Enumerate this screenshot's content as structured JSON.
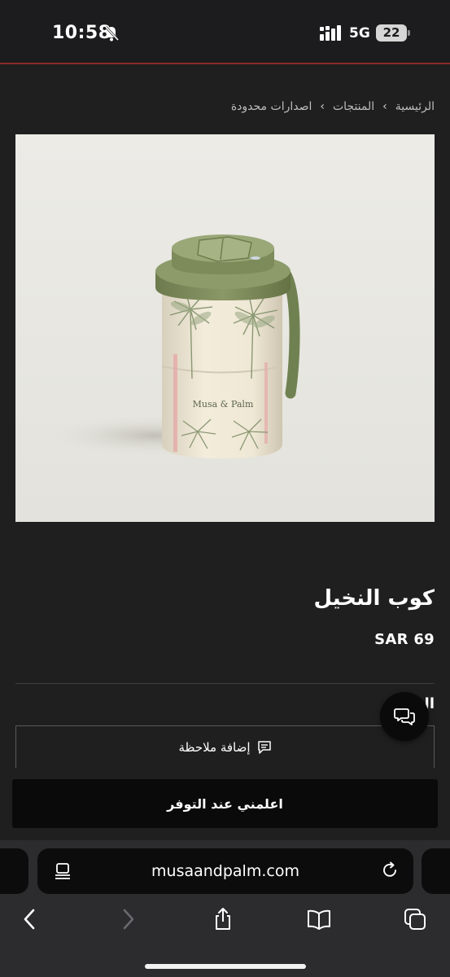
{
  "status_bar": {
    "time": "10:58",
    "network": "5G",
    "battery": "22"
  },
  "breadcrumb": {
    "home": "الرئيسية",
    "products": "المنتجات",
    "limited": "اصدارات محدودة",
    "separator": "›"
  },
  "product": {
    "image_brand_text": "Musa & Palm",
    "title": "كوب النخيل",
    "price": "SAR 69",
    "quantity_label_peek": "ال"
  },
  "actions": {
    "add_note": "إضافة ملاحظة",
    "notify_when_available": "اعلمني عند التوفر"
  },
  "browser": {
    "url": "musaandpalm.com"
  },
  "colors": {
    "background": "#1f1f1f",
    "button": "#0a0a0a",
    "cup_green": "#7e8c5e",
    "cup_body": "#efe8d6"
  }
}
